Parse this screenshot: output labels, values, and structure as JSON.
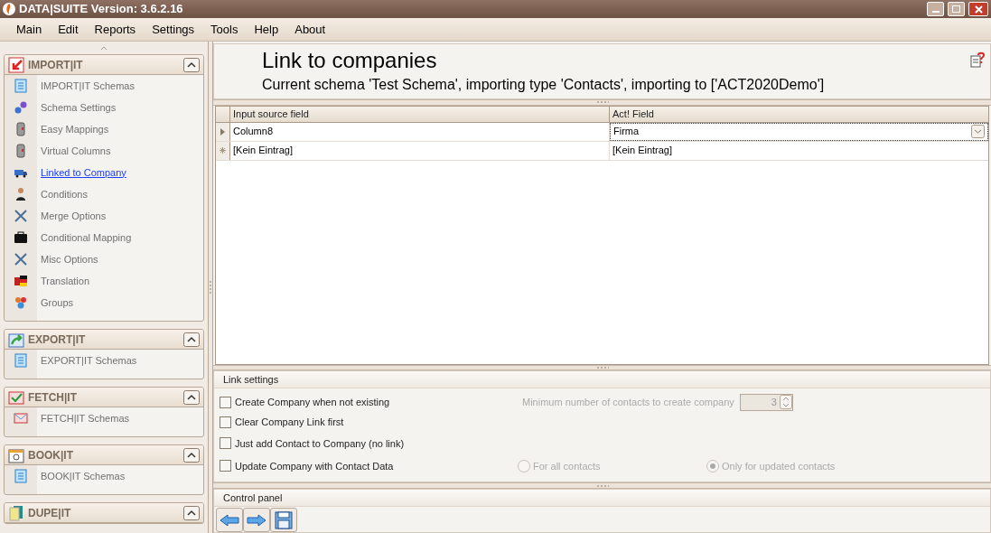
{
  "window": {
    "title": "DATA|SUITE Version: 3.6.2.16"
  },
  "menu": [
    "Main",
    "Edit",
    "Reports",
    "Settings",
    "Tools",
    "Help",
    "About"
  ],
  "sidebar": {
    "groups": [
      {
        "title": "IMPORT|IT",
        "items": [
          {
            "label": "IMPORT|IT Schemas",
            "selected": false
          },
          {
            "label": "Schema Settings",
            "selected": false
          },
          {
            "label": "Easy Mappings",
            "selected": false
          },
          {
            "label": "Virtual Columns",
            "selected": false
          },
          {
            "label": "Linked to Company",
            "selected": true
          },
          {
            "label": "Conditions",
            "selected": false
          },
          {
            "label": "Merge Options",
            "selected": false
          },
          {
            "label": "Conditional Mapping",
            "selected": false
          },
          {
            "label": "Misc Options",
            "selected": false
          },
          {
            "label": "Translation",
            "selected": false
          },
          {
            "label": "Groups",
            "selected": false
          }
        ]
      },
      {
        "title": "EXPORT|IT",
        "items": [
          {
            "label": "EXPORT|IT Schemas",
            "selected": false
          }
        ]
      },
      {
        "title": "FETCH|IT",
        "items": [
          {
            "label": "FETCH|IT Schemas",
            "selected": false
          }
        ]
      },
      {
        "title": "BOOK|IT",
        "items": [
          {
            "label": "BOOK|IT Schemas",
            "selected": false
          }
        ]
      },
      {
        "title": "DUPE|IT"
      }
    ]
  },
  "page": {
    "title": "Link to companies",
    "subtitle": "Current schema 'Test Schema', importing type 'Contacts', importing to ['ACT2020Demo']"
  },
  "grid": {
    "columns": [
      "Input source field",
      "Act! Field"
    ],
    "rows": [
      {
        "kind": "current",
        "cells": [
          "Column8",
          "Firma"
        ]
      },
      {
        "kind": "new",
        "cells": [
          "[Kein Eintrag]",
          "[Kein Eintrag]"
        ]
      }
    ]
  },
  "link_settings": {
    "title": "Link settings",
    "options": [
      {
        "label": "Create Company when not existing",
        "checked": false
      },
      {
        "label": "Clear Company Link first",
        "checked": false
      },
      {
        "label": "Just add Contact to Company (no link)",
        "checked": false
      },
      {
        "label": "Update Company with Contact Data",
        "checked": false
      }
    ],
    "min_contacts": {
      "label": "Minimum number of contacts to create company",
      "value": "3",
      "disabled": true
    },
    "update_scope": {
      "disabled": true,
      "options": [
        {
          "label": "For all contacts",
          "selected": false
        },
        {
          "label": "Only for updated contacts",
          "selected": true
        }
      ]
    }
  },
  "control_panel": {
    "title": "Control panel"
  }
}
